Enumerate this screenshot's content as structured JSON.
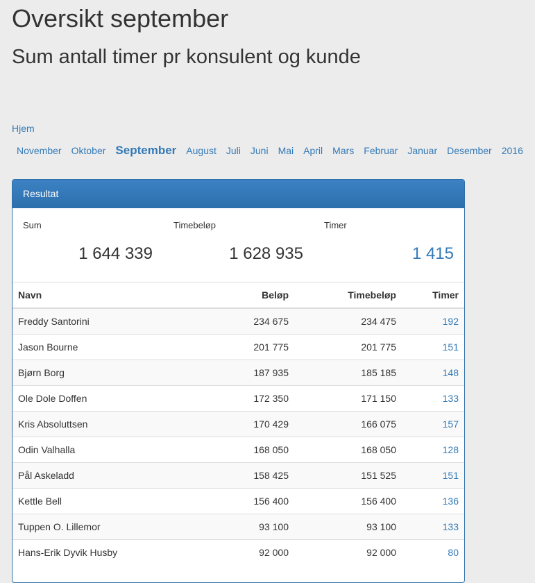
{
  "page": {
    "title": "Oversikt september",
    "subtitle": "Sum antall timer pr konsulent og kunde",
    "home_link": "Hjem"
  },
  "months": [
    {
      "label": "November",
      "active": false
    },
    {
      "label": "Oktober",
      "active": false
    },
    {
      "label": "September",
      "active": true
    },
    {
      "label": "August",
      "active": false
    },
    {
      "label": "Juli",
      "active": false
    },
    {
      "label": "Juni",
      "active": false
    },
    {
      "label": "Mai",
      "active": false
    },
    {
      "label": "April",
      "active": false
    },
    {
      "label": "Mars",
      "active": false
    },
    {
      "label": "Februar",
      "active": false
    },
    {
      "label": "Januar",
      "active": false
    },
    {
      "label": "Desember",
      "active": false
    },
    {
      "label": "2016",
      "active": false
    }
  ],
  "panel": {
    "heading": "Resultat",
    "summary": {
      "sum_label": "Sum",
      "sum_value": "1 644 339",
      "timebelop_label": "Timebeløp",
      "timebelop_value": "1 628 935",
      "timer_label": "Timer",
      "timer_value": "1 415"
    },
    "table": {
      "headers": [
        "Navn",
        "Beløp",
        "Timebeløp",
        "Timer"
      ],
      "rows": [
        [
          "Freddy Santorini",
          "234 675",
          "234 475",
          "192"
        ],
        [
          "Jason Bourne",
          "201 775",
          "201 775",
          "151"
        ],
        [
          "Bjørn Borg",
          "187 935",
          "185 185",
          "148"
        ],
        [
          "Ole Dole Doffen",
          "172 350",
          "171 150",
          "133"
        ],
        [
          "Kris Absoluttsen",
          "170 429",
          "166 075",
          "157"
        ],
        [
          "Odin Valhalla",
          "168 050",
          "168 050",
          "128"
        ],
        [
          "Pål Askeladd",
          "158 425",
          "151 525",
          "151"
        ],
        [
          "Kettle Bell",
          "156 400",
          "156 400",
          "136"
        ],
        [
          "Tuppen O. Lillemor",
          "93 100",
          "93 100",
          "133"
        ],
        [
          "Hans-Erik Dyvik Husby",
          "92 000",
          "92 000",
          "80"
        ]
      ]
    }
  }
}
